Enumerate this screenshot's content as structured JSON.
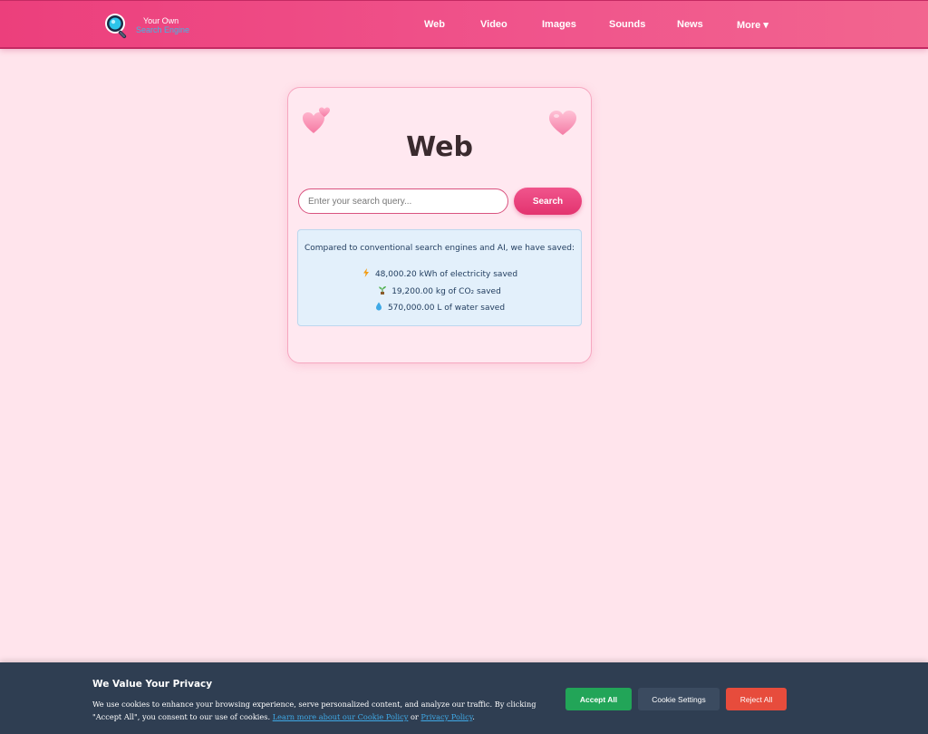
{
  "header": {
    "logo": {
      "line1": "Your Own",
      "line2": "Search Engine"
    },
    "nav": [
      {
        "label": "Web"
      },
      {
        "label": "Video"
      },
      {
        "label": "Images"
      },
      {
        "label": "Sounds"
      },
      {
        "label": "News"
      },
      {
        "label": "More ▾"
      }
    ]
  },
  "main": {
    "title": "Web",
    "search": {
      "placeholder": "Enter your search query...",
      "value": "",
      "button_label": "Search"
    },
    "savings": {
      "intro": "Compared to conventional search engines and AI, we have saved:",
      "items": [
        {
          "icon": "lightning-icon",
          "text": "48,000.20 kWh of electricity saved"
        },
        {
          "icon": "seedling-icon",
          "text": "19,200.00 kg of CO₂ saved"
        },
        {
          "icon": "water-drop-icon",
          "text": "570,000.00 L of water saved"
        }
      ]
    }
  },
  "cookie_banner": {
    "title": "We Value Your Privacy",
    "text": "We use cookies to enhance your browsing experience, serve personalized content, and analyze our traffic. By clicking \"Accept All\", you consent to our use of cookies.",
    "link_cookie_policy": "Learn more about our Cookie Policy",
    "or": "or",
    "link_privacy_policy": "Privacy Policy",
    "period": ".",
    "accept_label": "Accept All",
    "settings_label": "Cookie Settings",
    "reject_label": "Reject All"
  },
  "colors": {
    "header": "#ec3f7c",
    "page_background": "#ffe4ec",
    "accent": "#e3336f",
    "accept": "#22a558",
    "reject": "#e74c3c",
    "banner": "#2f3e52"
  }
}
